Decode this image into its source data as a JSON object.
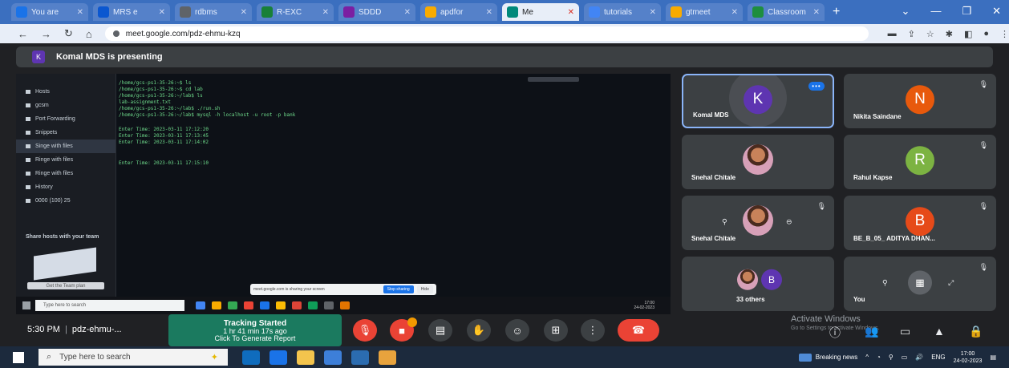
{
  "browser": {
    "tabs": [
      {
        "label": "You are",
        "color": "#1a73e8",
        "active": false
      },
      {
        "label": "MRS e",
        "color": "#0b57d0",
        "active": false
      },
      {
        "label": "rdbms",
        "color": "#5f6368",
        "active": false
      },
      {
        "label": "R-EXC",
        "color": "#188038",
        "active": false
      },
      {
        "label": "SDDD",
        "color": "#7b1fa2",
        "active": false
      },
      {
        "label": "apdfor",
        "color": "#f9ab00",
        "active": false
      },
      {
        "label": "Me",
        "color": "#00897b",
        "active": true
      },
      {
        "label": "tutorials",
        "color": "#4285f4",
        "active": false
      },
      {
        "label": "gtmeet",
        "color": "#f9ab00",
        "active": false
      },
      {
        "label": "Classroom",
        "color": "#1e8e3e",
        "active": false
      }
    ],
    "new_tab": "+",
    "url": "meet.google.com/pdz-ehmu-kzq"
  },
  "meeting": {
    "presenter_initial": "K",
    "presenting_text": "Komal MDS is presenting",
    "time": "5:30 PM",
    "code": "pdz-ehmu-...",
    "tracking": {
      "line1": "Tracking Started",
      "line2": "1 hr 41 min 17s ago",
      "line3": "Click To Generate Report"
    },
    "activate_title": "Activate Windows",
    "activate_sub": "Go to Settings to activate Windows."
  },
  "participants": [
    {
      "name": "Komal MDS",
      "initial": "K",
      "color": "#5e35b1",
      "type": "avatar"
    },
    {
      "name": "Nikita Saindane",
      "initial": "N",
      "color": "#e8590c",
      "type": "avatar"
    },
    {
      "name": "Snehal Chitale",
      "type": "photo"
    },
    {
      "name": "Rahul Kapse",
      "initial": "R",
      "color": "#7cb342",
      "type": "avatar"
    },
    {
      "name": "Snehal Chitale",
      "type": "photo-pinned"
    },
    {
      "name": "BE_B_05_ ADITYA DHAN...",
      "initial": "B",
      "color": "#e64a19",
      "type": "avatar"
    },
    {
      "name": "33 others",
      "initial": "B",
      "color": "#5e35b1",
      "type": "group"
    },
    {
      "name": "You",
      "type": "self"
    }
  ],
  "shared_screen": {
    "sidebar_items": [
      "Hosts",
      "gcsm",
      "Port Forwarding",
      "Snippets",
      "Singe with files",
      "Ringe with files",
      "Ringe with files",
      "History",
      "0000 (100) 25"
    ],
    "sidebar_promo": "Share hosts with your team",
    "sidebar_btn": "Get the Team plan",
    "terminal": [
      "/home/gcs-ps1-35-26:~$ ls",
      "/home/gcs-ps1-35-26:~$ cd lab",
      "/home/gcs-ps1-35-26:~/lab$ ls",
      "lab-assignment.txt",
      "/home/gcs-ps1-35-26:~/lab$ ./run.sh",
      "/home/gcs-ps1-35-26:~/lab$ mysql -h localhost -u root -p bank"
    ],
    "terminal2": [
      "Enter Time: 2023-03-11 17:12:20",
      "Enter Time: 2023-03-11 17:13:45",
      "Enter Time: 2023-03-11 17:14:02"
    ],
    "terminal3": "Enter Time: 2023-03-11 17:15:10",
    "notif_text": "meet.google.com is sharing your screen",
    "notif_stop": "Stop sharing",
    "notif_hide": "Hide",
    "inner_search": "Type here to search",
    "inner_time": "17:00",
    "inner_date": "24-02-2023"
  },
  "taskbar": {
    "search_placeholder": "Type here to search",
    "news": "Breaking news",
    "lang": "ENG",
    "time": "17:00",
    "date": "24-02-2023"
  }
}
